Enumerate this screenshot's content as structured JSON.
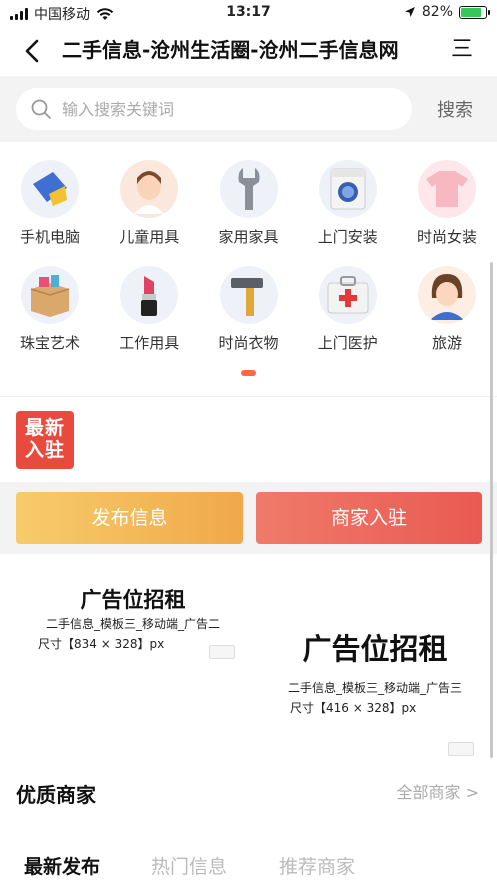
{
  "status": {
    "carrier": "中国移动",
    "time": "13:17",
    "battery": "82%",
    "battery_level": 0.82
  },
  "nav": {
    "back_icon": "chevron-left-icon",
    "title": "二手信息-沧州生活圈-沧州二手信息网",
    "menu_icon": "menu-icon",
    "menu_glyph": "三"
  },
  "search": {
    "placeholder": "输入搜索关键词",
    "button": "搜索"
  },
  "categories": [
    {
      "label": "手机电脑",
      "icon": "computer-icon"
    },
    {
      "label": "儿童用具",
      "icon": "child-icon"
    },
    {
      "label": "家用家具",
      "icon": "wrench-icon"
    },
    {
      "label": "上门安装",
      "icon": "washing-machine-icon"
    },
    {
      "label": "时尚女装",
      "icon": "tshirt-icon"
    },
    {
      "label": "珠宝艺术",
      "icon": "box-icon"
    },
    {
      "label": "工作用具",
      "icon": "lipstick-icon"
    },
    {
      "label": "时尚衣物",
      "icon": "hammer-icon"
    },
    {
      "label": "上门医护",
      "icon": "medical-kit-icon"
    },
    {
      "label": "旅游",
      "icon": "person-icon"
    }
  ],
  "badge": {
    "line1": "最新",
    "line2": "入驻"
  },
  "actions": {
    "publish": "发布信息",
    "join": "商家入驻"
  },
  "ads": [
    {
      "title": "广告位招租",
      "line1": "二手信息_模板三_移动端_广告二",
      "line2": "尺寸【834 × 328】px"
    },
    {
      "title": "广告位招租",
      "line1": "二手信息_模板三_移动端_广告三",
      "line2": "尺寸【416 × 328】px"
    }
  ],
  "merchants": {
    "title": "优质商家",
    "all_link": "全部商家 >"
  },
  "tabs": [
    {
      "label": "最新发布",
      "active": true
    },
    {
      "label": "热门信息",
      "active": false
    },
    {
      "label": "推荐商家",
      "active": false
    }
  ],
  "colors": {
    "accent": "#ff6a3d",
    "publish": "#f0a84a",
    "join": "#e95a52",
    "badge": "#e84a3e"
  }
}
